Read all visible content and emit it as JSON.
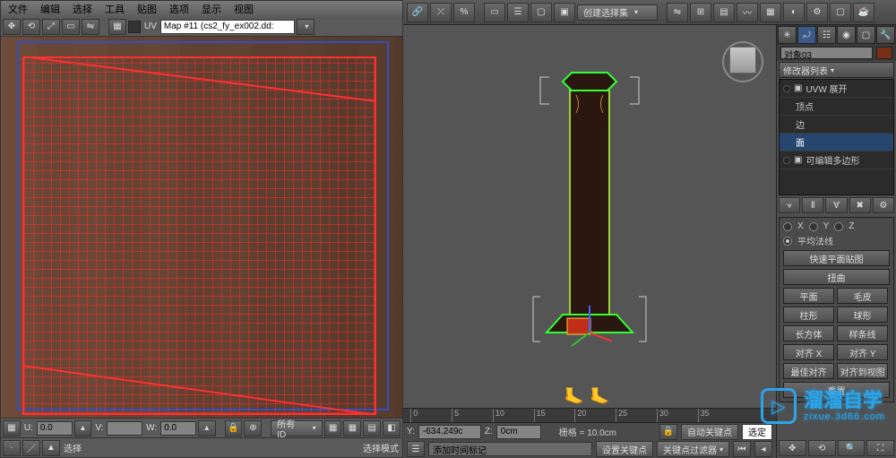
{
  "uv": {
    "menu": [
      "文件",
      "编辑",
      "选择",
      "工具",
      "贴图",
      "选项",
      "显示",
      "视图"
    ],
    "check_label": "UV",
    "map_input": "Map #11 (cs2_fy_ex002.dd:",
    "u_label": "U:",
    "u_value": "0.0",
    "v_label": "V:",
    "v_value": "",
    "w_label": "W:",
    "w_value": "0.0",
    "id_dropdown": "所有 ID",
    "bottom_sel": "选择",
    "bottom_mode": "选择模式"
  },
  "main_toolbar": {
    "selset_label": "创建选择集"
  },
  "viewport": {
    "ruler_ticks": [
      {
        "pos": 2,
        "label": "0"
      },
      {
        "pos": 13,
        "label": "5"
      },
      {
        "pos": 24,
        "label": "10"
      },
      {
        "pos": 35,
        "label": "15"
      },
      {
        "pos": 46,
        "label": "20"
      },
      {
        "pos": 57,
        "label": "25"
      },
      {
        "pos": 68,
        "label": "30"
      },
      {
        "pos": 79,
        "label": "35"
      }
    ]
  },
  "status": {
    "y_label": "Y:",
    "y_value": "-634.249c",
    "z_label": "Z:",
    "z_value": "0cm",
    "grid_label": "栅格 = 10.0cm",
    "autokey": "自动关键点",
    "selkey": "选定",
    "addtime": "添加时间标记",
    "setkey": "设置关键点",
    "keyfilter": "关键点过滤器"
  },
  "cmd": {
    "obj_label": "对象03",
    "mod_list_label": "修改器列表",
    "stack": {
      "uvw": "UVW 展开",
      "sub_vertex": "顶点",
      "sub_edge": "边",
      "sub_face": "面",
      "editable": "可编辑多边形"
    },
    "axes": {
      "x": "X",
      "y": "Y",
      "z": "Z"
    },
    "avg_normal": "平均法线",
    "quick_planar": "快速平面贴图",
    "twist": "扭曲",
    "btns": {
      "plane": "平面",
      "fur": "毛皮",
      "cyl": "柱形",
      "sphere": "球形",
      "box": "长方体",
      "spline": "样条线",
      "alignx": "对齐 X",
      "aligny": "对齐 Y",
      "bestalign": "最佳对齐",
      "toview": "对齐到视图",
      "reset": "重置"
    }
  },
  "watermark": {
    "main": "溜溜自学",
    "sub": "zixue.3d66.com"
  }
}
